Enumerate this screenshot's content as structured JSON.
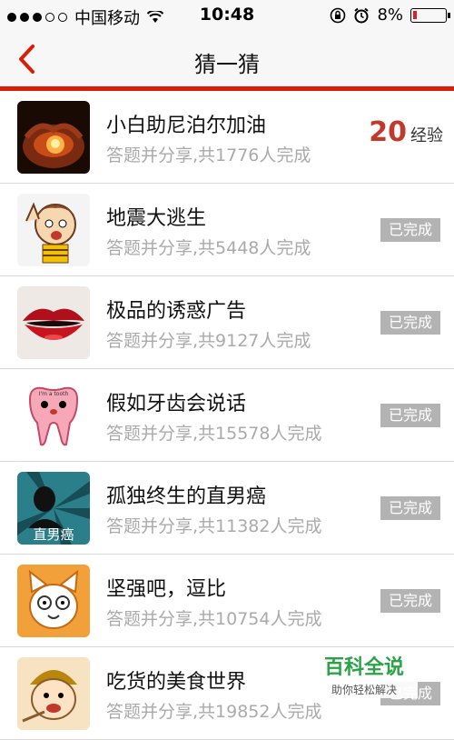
{
  "status_bar": {
    "carrier": "中国移动",
    "time": "10:48",
    "battery": "8%"
  },
  "nav": {
    "title": "猜一猜"
  },
  "items": [
    {
      "title": "小白助尼泊尔加油",
      "subtitle": "答题并分享,共1776人完成",
      "reward_value": "20",
      "reward_unit": "经验"
    },
    {
      "title": "地震大逃生",
      "subtitle": "答题并分享,共5448人完成",
      "status": "已完成"
    },
    {
      "title": "极品的诱惑广告",
      "subtitle": "答题并分享,共9127人完成",
      "status": "已完成"
    },
    {
      "title": "假如牙齿会说话",
      "subtitle": "答题并分享,共15578人完成",
      "status": "已完成",
      "thumb_text": "I'm a tooth"
    },
    {
      "title": "孤独终生的直男癌",
      "subtitle": "答题并分享,共11382人完成",
      "status": "已完成",
      "thumb_text": "直男癌"
    },
    {
      "title": "坚强吧，逗比",
      "subtitle": "答题并分享,共10754人完成",
      "status": "已完成"
    },
    {
      "title": "吃货的美食世界",
      "subtitle": "答题并分享,共19852人完成",
      "status": "已完成"
    }
  ],
  "watermark": {
    "main": "百科全说",
    "sub": "助你轻松解决"
  },
  "colors": {
    "accent_red": "#d81e06",
    "badge_gray": "#b3b3b3",
    "watermark_green": "#2aa346"
  }
}
